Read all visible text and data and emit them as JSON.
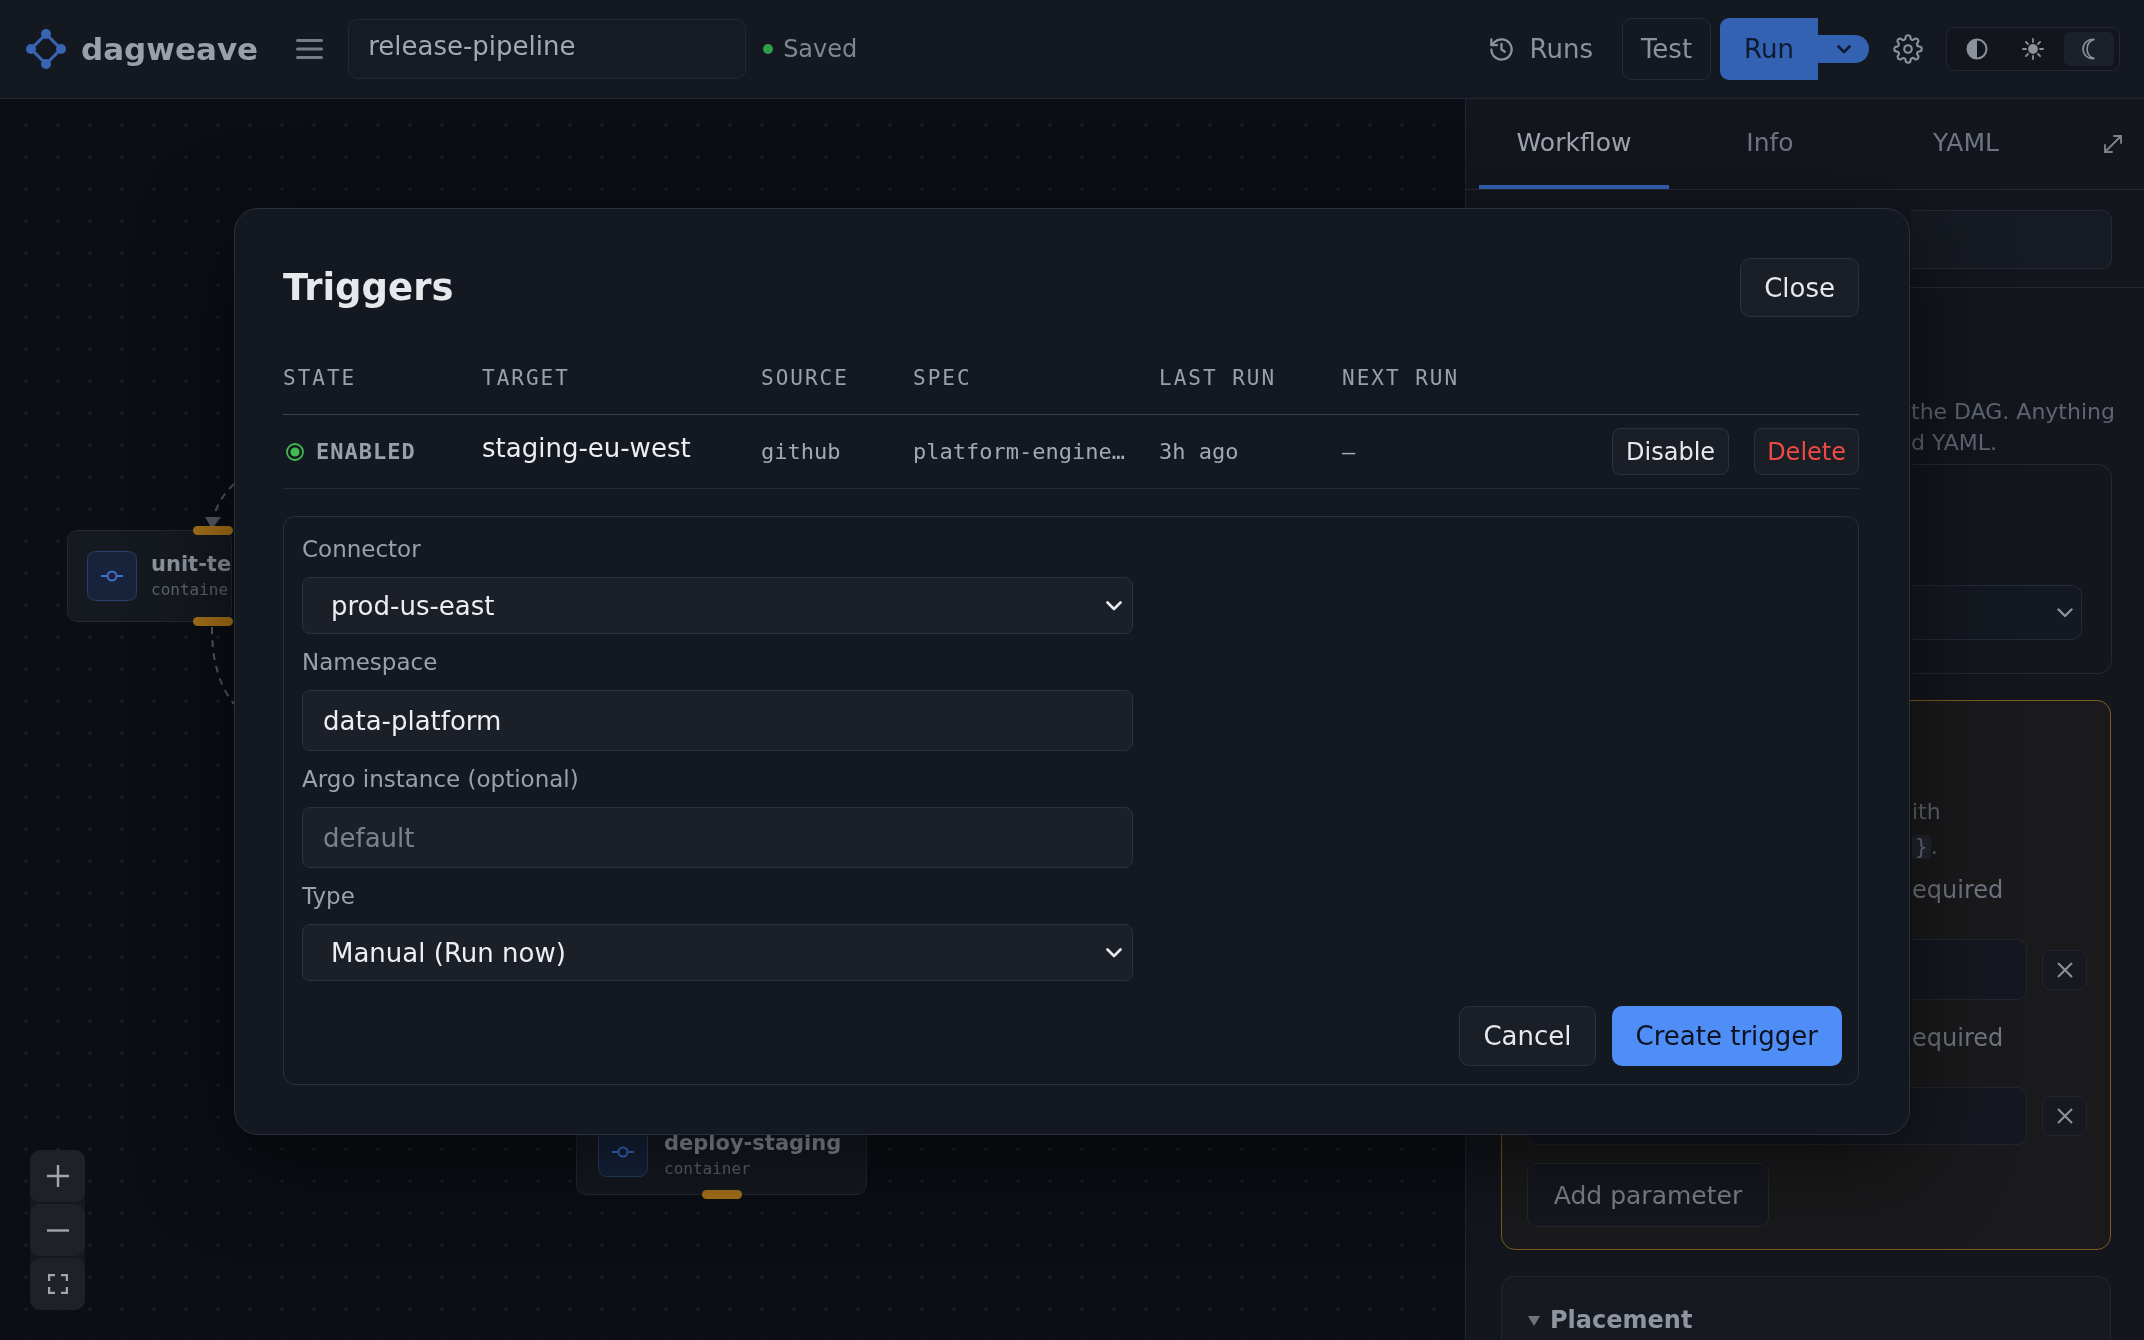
{
  "top_bar": {
    "brand": "dagweave",
    "workflow_name": "release-pipeline",
    "saved": true,
    "save_status": "Saved",
    "runs_label": "Runs",
    "test_label": "Test",
    "run_label": "Run",
    "theme_options": [
      {
        "kind": "system",
        "selected": false
      },
      {
        "kind": "light",
        "selected": false
      },
      {
        "kind": "dark",
        "selected": true
      }
    ]
  },
  "canvas": {
    "nodes": [
      {
        "title": "unit-te",
        "subtitle": "containe"
      },
      {
        "title": "deploy-staging",
        "subtitle": "container"
      }
    ]
  },
  "right_panel": {
    "tabs": [
      {
        "label": "Workflow",
        "selected": true
      },
      {
        "label": "Info",
        "selected": false
      },
      {
        "label": "YAML",
        "selected": false
      }
    ],
    "description_fragments": [
      "the DAG. Anything",
      "d YAML."
    ],
    "parameters": {
      "hint_fragment": "ith",
      "code_fragment": "}",
      "hint_end": ".",
      "rows": [
        {
          "required_fragment": "equired"
        },
        {
          "required_fragment": "equired"
        }
      ],
      "add_label": "Add parameter"
    },
    "placement": {
      "title": "Placement",
      "expanded": true
    }
  },
  "modal": {
    "title": "Triggers",
    "close_label": "Close",
    "columns": [
      "STATE",
      "TARGET",
      "SOURCE",
      "SPEC",
      "LAST RUN",
      "NEXT RUN"
    ],
    "rows": [
      {
        "enabled": true,
        "state": "ENABLED",
        "target": "staging-eu-west",
        "source": "github",
        "spec": "platform-engine…",
        "last_run": "3h ago",
        "next_run": "–",
        "actions": [
          {
            "label": "Disable",
            "kind": "default"
          },
          {
            "label": "Delete",
            "kind": "danger"
          }
        ]
      }
    ],
    "form": {
      "fields": [
        {
          "kind": "select",
          "label": "Connector",
          "value": "prod-us-east"
        },
        {
          "kind": "input",
          "label": "Namespace",
          "value": "data-platform"
        },
        {
          "kind": "input",
          "label": "Argo instance (optional)",
          "placeholder": "default"
        },
        {
          "kind": "select",
          "label": "Type",
          "value": "Manual (Run now)"
        }
      ],
      "cancel_label": "Cancel",
      "submit_label": "Create trigger"
    }
  }
}
